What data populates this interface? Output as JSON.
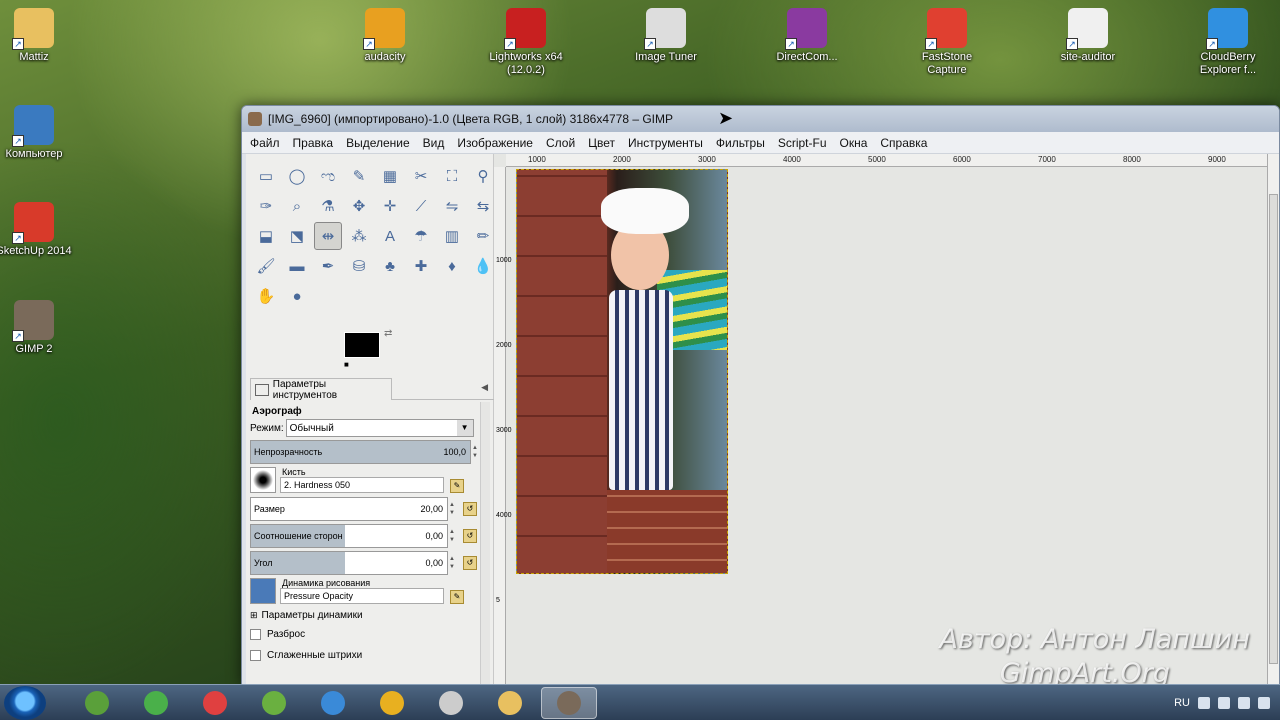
{
  "desktop": {
    "icons": [
      {
        "label": "Mattiz",
        "icon": "user-folder-icon",
        "color": "#e8c060"
      },
      {
        "label": "audacity",
        "icon": "audacity-icon",
        "color": "#e8a020"
      },
      {
        "label": "Lightworks x64 (12.0.2)",
        "icon": "lightworks-icon",
        "color": "#c82020"
      },
      {
        "label": "Image Tuner",
        "icon": "image-tuner-icon",
        "color": "#dddddd"
      },
      {
        "label": "DirectCom...",
        "icon": "directcom-icon",
        "color": "#8a3aa0"
      },
      {
        "label": "FastStone Capture",
        "icon": "faststone-icon",
        "color": "#e04030"
      },
      {
        "label": "site-auditor",
        "icon": "site-auditor-icon",
        "color": "#f0f0f0"
      },
      {
        "label": "CloudBerry Explorer f...",
        "icon": "cloudberry-icon",
        "color": "#3090e0"
      },
      {
        "label": "Компьютер",
        "icon": "computer-icon",
        "color": "#3a7ac0"
      },
      {
        "label": "SketchUp 2014",
        "icon": "sketchup-icon",
        "color": "#d83a2a"
      },
      {
        "label": "GIMP 2",
        "icon": "gimp-icon",
        "color": "#7a6a5a"
      }
    ]
  },
  "gimp": {
    "title": "[IMG_6960] (импортировано)-1.0 (Цвета RGB, 1 слой) 3186x4778 – GIMP",
    "menu": [
      "Файл",
      "Правка",
      "Выделение",
      "Вид",
      "Изображение",
      "Слой",
      "Цвет",
      "Инструменты",
      "Фильтры",
      "Script-Fu",
      "Окна",
      "Справка"
    ],
    "tools": [
      "▭",
      "◯",
      "ಌ",
      "✎",
      "▦",
      "✂",
      "⛶",
      "⚲",
      "✑",
      "⌕",
      "⚗",
      "✥",
      "✛",
      "⟋",
      "⇋",
      "⇆",
      "⬓",
      "⬔",
      "⇹",
      "⁂",
      "A",
      "☂",
      "▥",
      "✏",
      "🖌",
      "▬",
      "✒",
      "⛁",
      "♣",
      "✚",
      "♦",
      "💧",
      "✋",
      "●"
    ],
    "active_tool_index": 18,
    "options_tab": "Параметры инструментов",
    "tool_name": "Аэрограф",
    "mode_label": "Режим:",
    "mode_value": "Обычный",
    "opacity_label": "Непрозрачность",
    "opacity_value": "100,0",
    "opacity_fraction": 1.0,
    "brush_label": "Кисть",
    "brush_value": "2. Hardness 050",
    "size_label": "Размер",
    "size_value": "20,00",
    "ratio_label": "Соотношение сторон",
    "ratio_value": "0,00",
    "angle_label": "Угол",
    "angle_value": "0,00",
    "dynamics_label": "Динамика рисования",
    "dynamics_value": "Pressure Opacity",
    "dynamics_options": "Параметры динамики",
    "scatter_label": "Разброс",
    "smooth_label": "Сглаженные штрихи",
    "ruler_marks": [
      "1000",
      "2000",
      "3000",
      "4000",
      "5000",
      "6000",
      "7000",
      "8000",
      "9000"
    ],
    "ruler_vertical": [
      "1000",
      "2000",
      "3000",
      "4000",
      "5"
    ]
  },
  "watermark": {
    "line1": "Автор: Антон Лапшин",
    "line2": "GimpArt.Org"
  },
  "taskbar": {
    "apps": [
      {
        "name": "evernote-icon",
        "color": "#5aa03a"
      },
      {
        "name": "xmind-icon",
        "color": "#4ab04a"
      },
      {
        "name": "color-wheel-icon",
        "color": "#e04040"
      },
      {
        "name": "chart-app-icon",
        "color": "#6ab040"
      },
      {
        "name": "browser-globe-icon",
        "color": "#3a8ad8"
      },
      {
        "name": "chrome-icon",
        "color": "#e8b020"
      },
      {
        "name": "image-tuner-task-icon",
        "color": "#cccccc"
      },
      {
        "name": "explorer-folder-icon",
        "color": "#e8c060"
      },
      {
        "name": "gimp-task-icon",
        "color": "#7a6a5a"
      }
    ],
    "active_app_index": 8,
    "language": "RU"
  }
}
